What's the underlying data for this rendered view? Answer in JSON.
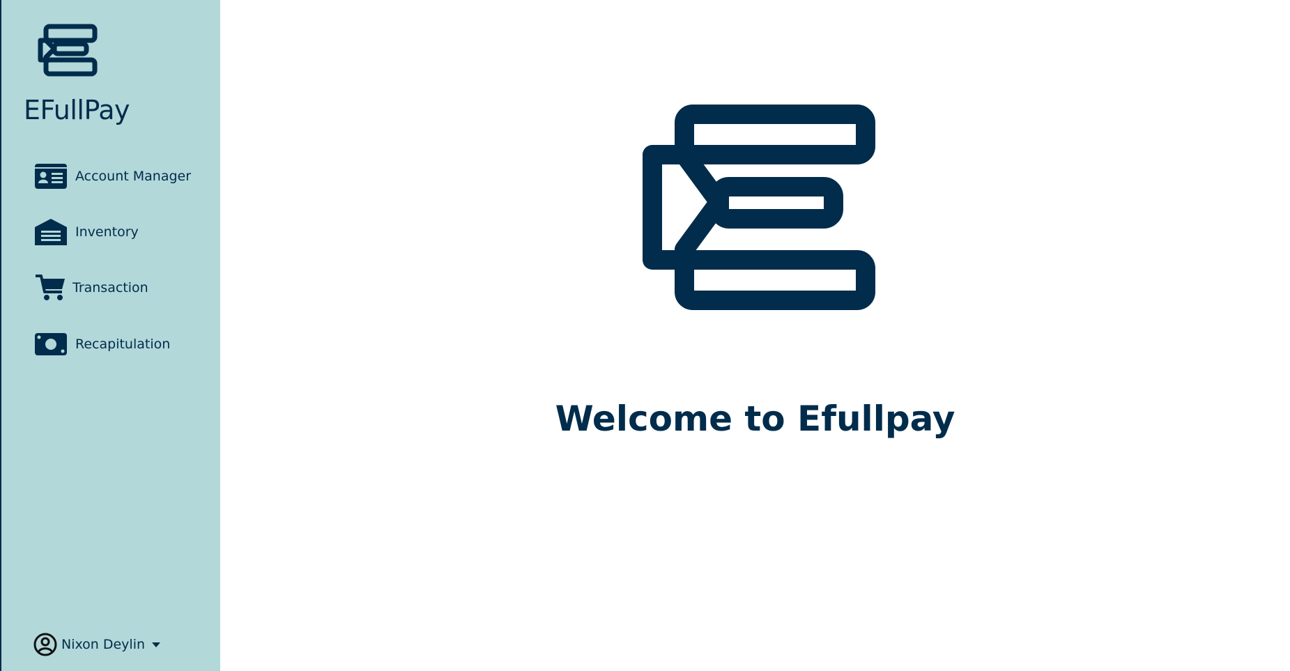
{
  "brand": {
    "name": "EFullPay",
    "logo_icon": "efullpay-logo-icon",
    "color": "#022c4b"
  },
  "sidebar": {
    "background": "#b2d8da",
    "items": [
      {
        "label": "Account Manager",
        "icon": "id-card-icon"
      },
      {
        "label": "Inventory",
        "icon": "warehouse-icon"
      },
      {
        "label": "Transaction",
        "icon": "cart-icon"
      },
      {
        "label": "Recapitulation",
        "icon": "money-bill-icon"
      }
    ],
    "user": {
      "name": "Nixon Deylin",
      "icon": "user-circle-icon"
    }
  },
  "main": {
    "welcome_text": "Welcome to Efullpay"
  }
}
